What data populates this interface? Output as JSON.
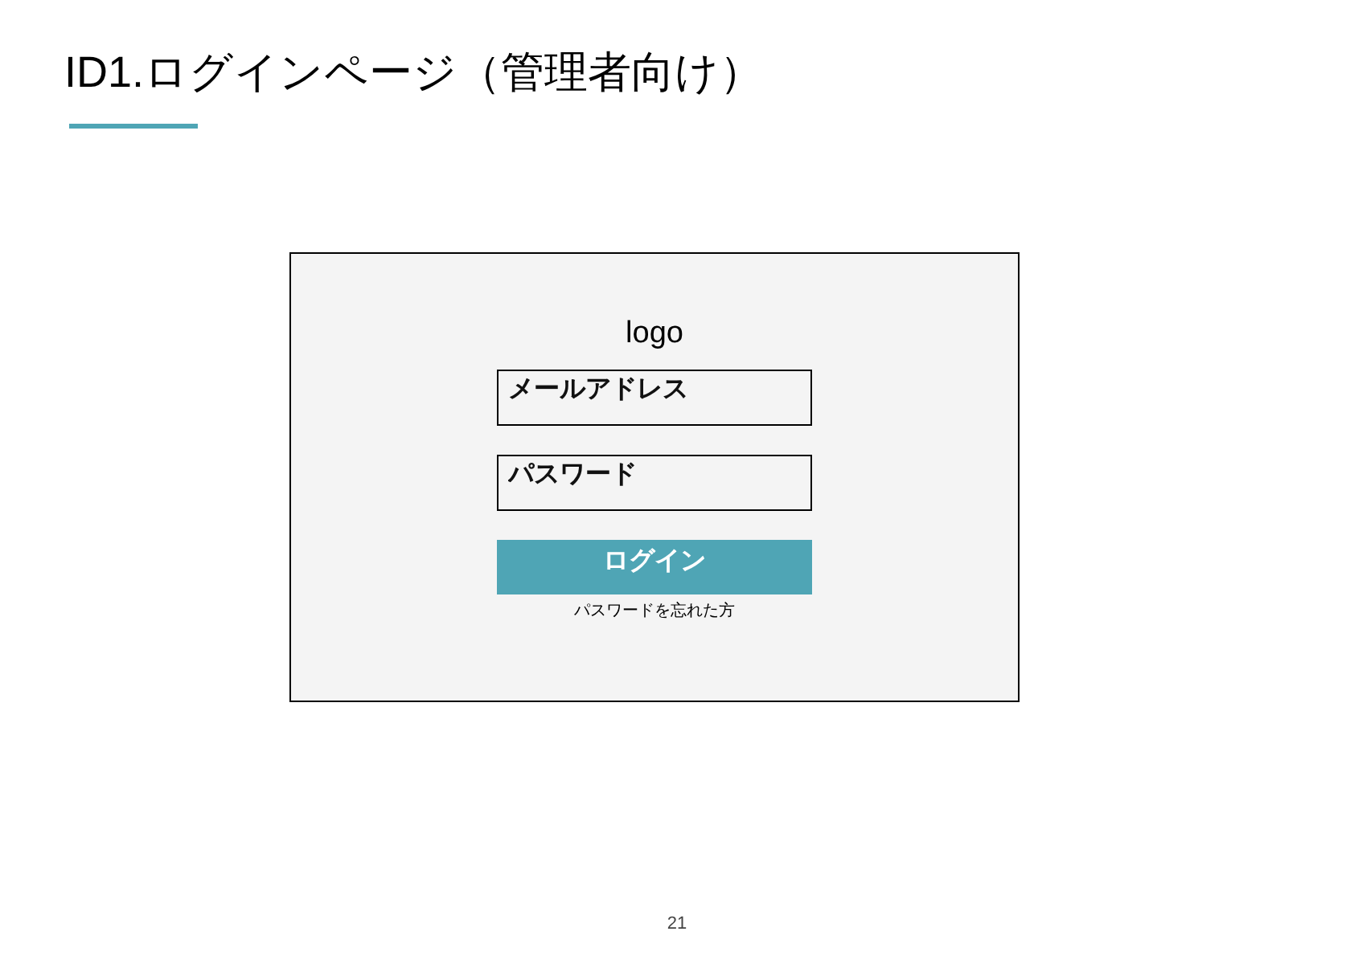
{
  "title": "ID1.ログインページ（管理者向け）",
  "login_form": {
    "logo": "logo",
    "fields": [
      {
        "placeholder": "メールアドレス"
      },
      {
        "placeholder": "パスワード"
      }
    ],
    "button": "ログイン",
    "link": "パスワードを忘れた方"
  },
  "page_number": "21"
}
